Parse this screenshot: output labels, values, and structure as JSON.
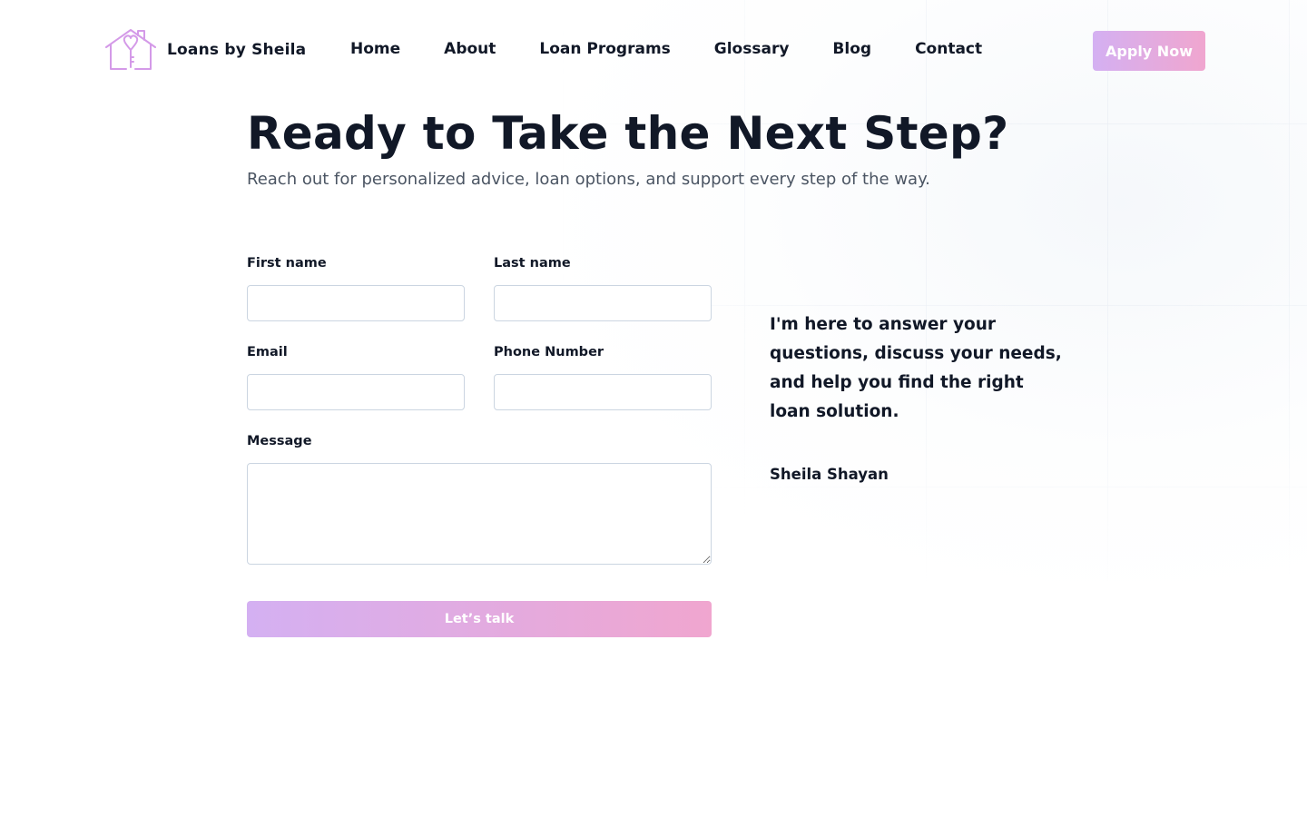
{
  "header": {
    "brand_name": "Loans by Sheila",
    "logo_icon": "house-key-heart-icon",
    "nav": [
      {
        "label": "Home"
      },
      {
        "label": "About"
      },
      {
        "label": "Loan Programs"
      },
      {
        "label": "Glossary"
      },
      {
        "label": "Blog"
      },
      {
        "label": "Contact"
      }
    ],
    "apply_label": "Apply Now"
  },
  "hero": {
    "title": "Ready to Take the Next Step?",
    "subtitle": "Reach out for personalized advice, loan options, and support every step of the way."
  },
  "form": {
    "first_name": {
      "label": "First name",
      "value": ""
    },
    "last_name": {
      "label": "Last name",
      "value": ""
    },
    "email": {
      "label": "Email",
      "value": ""
    },
    "phone": {
      "label": "Phone Number",
      "value": ""
    },
    "message": {
      "label": "Message",
      "value": ""
    },
    "submit_label": "Let’s talk"
  },
  "side": {
    "quote": "I'm here to answer your questions, discuss your needs, and help you find the right loan solution.",
    "signature": "Sheila Shayan"
  },
  "colors": {
    "accent_gradient_start": "#d4b0f2",
    "accent_gradient_end": "#f0a6cf",
    "logo_stroke": "#d49ae8",
    "text_primary": "#111827",
    "text_secondary": "#4b5563",
    "input_border": "#cbd5e1"
  }
}
